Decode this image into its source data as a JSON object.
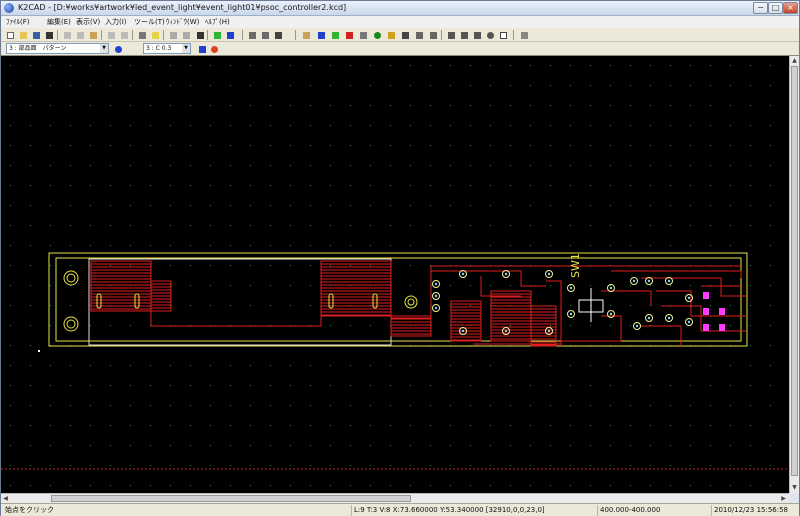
{
  "window": {
    "title": "K2CAD - [D:¥works¥artwork¥led_event_light¥event_light01¥psoc_controller2.kcd]",
    "buttons": [
      "−",
      "□",
      "×"
    ]
  },
  "menu": [
    "ﾌｧｲﾙ(F)",
    "編集(E)",
    "表示(V)",
    "入力(I)",
    "ツール(T)",
    "ｳｨﾝﾄﾞｳ(W)",
    "ﾍﾙﾌﾟ(H)"
  ],
  "toolbar2": {
    "layer_select": "3 : 部品面　パターン",
    "width_select": "3 : C 0.3"
  },
  "pcb": {
    "switch_label": "SW1",
    "colors": {
      "outline": "#e6e24a",
      "copper": "#e01e1e",
      "silk": "#ffffff",
      "pad": "#f4f4a0",
      "via": "#7fd7ff",
      "part": "#ff3cff"
    }
  },
  "status": {
    "hint": "始点をクリック",
    "coords": "L:9 T:3 V:8 X:73.660000 Y:53.340000 [32910,0,0,23,0]",
    "scale": "400.000-400.000",
    "datetime": "2010/12/23   15:56:58"
  }
}
